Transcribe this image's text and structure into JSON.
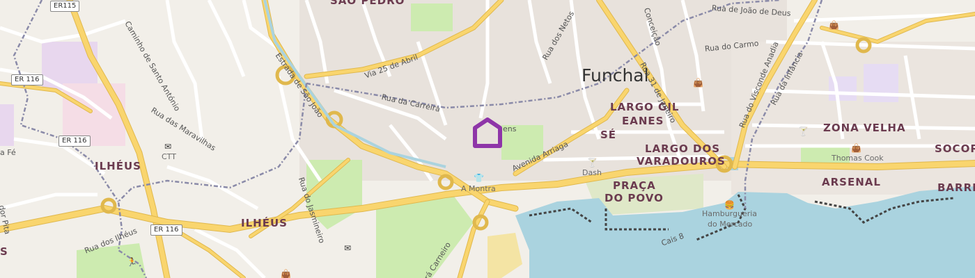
{
  "city": "Funchal",
  "districts": {
    "sao_pedro": "SÃO PEDRO",
    "largo_gil_eanes_1": "LARGO GIL",
    "largo_gil_eanes_2": "EANES",
    "se": "SÉ",
    "largo_dos_varadouros_1": "LARGO DOS",
    "largo_dos_varadouros_2": "VARADOUROS",
    "zona_velha": "ZONA VELHA",
    "socorro": "SOCORR",
    "arsenal": "ARSENAL",
    "barreiros": "BARREI",
    "praca_do_povo_1": "PRAÇA",
    "praca_do_povo_2": "DO POVO",
    "ilheus_west": "ILHÉUS",
    "ilheus_south": "ILHÉUS",
    "edge_s": "S"
  },
  "pois": {
    "ctt": "CTT",
    "dash": "Dash",
    "a_montra": "A Montra",
    "thomas_cook": "Thomas Cook",
    "hamburgueria_1": "Hamburgueria",
    "hamburgueria_2": "do Mercado"
  },
  "roads": {
    "er115": "ER115",
    "er116_a": "ER 116",
    "er116_b": "ER 116",
    "er116_c": "ER 116",
    "rua_joao_de_deus": "Rua de João de Deus",
    "rua_do_carmo": "Rua do Carmo",
    "rua_31_janeiro": "Rua 31 de Janeiro",
    "rua_visconde_anadia": "Rua do Visconde Anadia",
    "rua_da_infancia": "Rua da Infância",
    "rua_dos_netos": "Rua dos Netos",
    "conceicao": "Conceição",
    "via_25_abril": "Via 25 de Abril",
    "rua_da_carreira": "Rua da Carreira",
    "estrada_sao_joao": "Estrada de São João",
    "avenida_arriaga": "Avenida Arriaga",
    "caminho_santo_antonio": "Caminho de Santo António",
    "rua_maravilhas": "Rua das Maravilhas",
    "rua_jasmineiro": "Rua do Jasmineiro",
    "rua_dos_ilheus": "Rua dos Ilhéus",
    "cais_8": "Cais 8",
    "rua_carneiro": "rá Carneiro",
    "rua_pita": "dor Pita",
    "rua_fe": "a Fé",
    "rua_ens": "ens"
  },
  "marker": {
    "color": "#8e35a8"
  },
  "colors": {
    "land": "#f2efe9",
    "sea": "#aad3df",
    "major_road": "#f9d56e",
    "park": "#cdebb0",
    "boundary": "#8a8aa8",
    "label_district": "#6b3b4f"
  }
}
